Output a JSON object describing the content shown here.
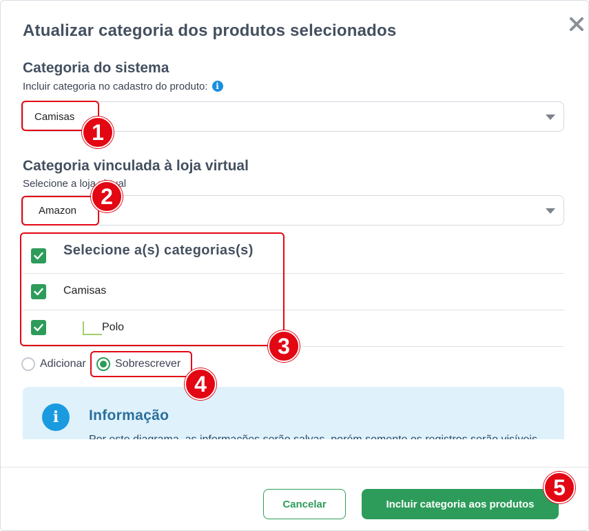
{
  "dialog": {
    "title": "Atualizar categoria dos produtos selecionados",
    "close_icon": "close-icon"
  },
  "system_category": {
    "heading": "Categoria do sistema",
    "help": "Incluir categoria no cadastro do produto:",
    "info_icon": "i",
    "selected": "Camisas"
  },
  "store_category": {
    "heading": "Categoria vinculada à loja virtual",
    "help": "Selecione a loja virtual",
    "selected": "Amazon"
  },
  "categories": {
    "header": "Selecione a(s) categorias(s)",
    "items": [
      {
        "label": "Camisas",
        "checked": true,
        "level": 0
      },
      {
        "label": "Polo",
        "checked": true,
        "level": 1
      }
    ]
  },
  "mode": {
    "options": [
      "Adicionar",
      "Sobrescrever"
    ],
    "selected": "Sobrescrever"
  },
  "info": {
    "icon": "i",
    "title": "Informação",
    "text": "Por este diagrama, as informações serão salvas, porém somente os registros serão visíveis"
  },
  "footer": {
    "cancel_label": "Cancelar",
    "submit_label": "Incluir categoria aos produtos"
  },
  "annotations": [
    "1",
    "2",
    "3",
    "4",
    "5"
  ],
  "colors": {
    "accent_green": "#2d9c5a",
    "annotation_red": "#e30613",
    "info_blue": "#1a9be0"
  }
}
